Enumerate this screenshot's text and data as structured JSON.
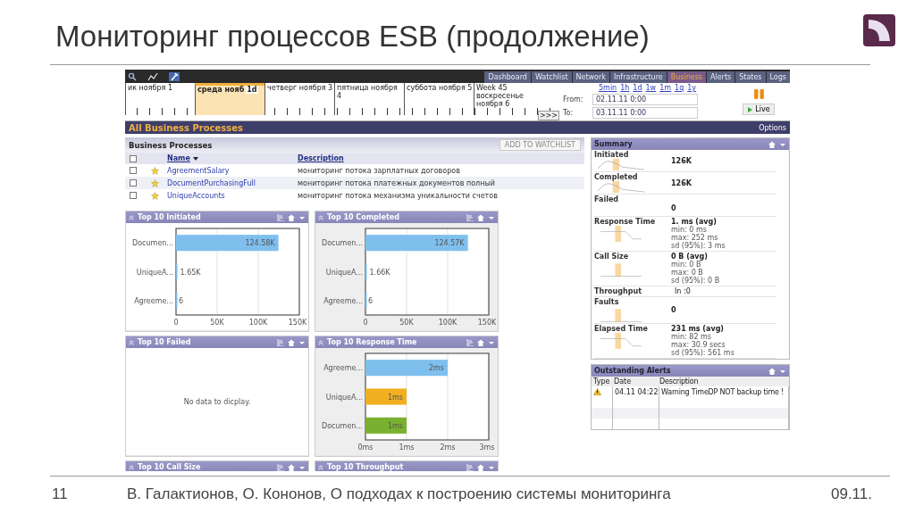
{
  "slide": {
    "title": "Мониторинг процессов ESB (продолжение)",
    "footer": {
      "page": "11",
      "text": "В. Галактионов, О. Кононов, О подходах к построению системы мониторинга",
      "date": "09.11."
    }
  },
  "tabs": [
    {
      "label": "Dashboard",
      "selected": false
    },
    {
      "label": "Watchlist",
      "selected": false
    },
    {
      "label": "Network",
      "selected": false
    },
    {
      "label": "Infrastructure",
      "selected": false
    },
    {
      "label": "Business",
      "selected": true
    },
    {
      "label": "Alerts",
      "selected": false
    },
    {
      "label": "States",
      "selected": false
    },
    {
      "label": "Logs",
      "selected": false
    }
  ],
  "timeline": {
    "days": [
      {
        "label": "ик ноября 1",
        "selected": false
      },
      {
        "label": "среда нояб",
        "selected": true,
        "badge": "1d"
      },
      {
        "label": "четверг ноября 3",
        "selected": false
      },
      {
        "label": "пятница ноября 4",
        "selected": false
      },
      {
        "label": "суббота ноября 5",
        "selected": false
      },
      {
        "label": "воскресенье ноября 6",
        "selected": false,
        "week": "Week 45"
      }
    ],
    "scroll": ">>>",
    "ranges": [
      "5min",
      "1h",
      "1d",
      "1w",
      "1m",
      "1q",
      "1y"
    ],
    "from_label": "From:",
    "from": "02.11.11 0:00",
    "to_label": "To:",
    "to": "03.11.11 0:00",
    "live": "Live"
  },
  "section": {
    "title": "All Business Processes",
    "options": "Options"
  },
  "business": {
    "title": "Business Processes",
    "add_button": "ADD TO WATCHLIST",
    "all_checked": false,
    "columns": [
      "Name",
      "Description"
    ],
    "rows": [
      {
        "name": "AgreementSalary",
        "description": "мониторинг потока зарплатных договоров",
        "checked": false
      },
      {
        "name": "DocumentPurchasingFull",
        "description": "мониторинг потока платежных документов полный",
        "checked": false
      },
      {
        "name": "UniqueAccounts",
        "description": "мониторинг потока механизма уникальности счетов",
        "checked": false
      }
    ]
  },
  "panels": [
    {
      "title": "Top 10 Initiated",
      "chart_data": {
        "type": "bar",
        "orientation": "horizontal",
        "categories": [
          "Documen...",
          "UniqueA...",
          "Agreeme..."
        ],
        "series": [
          {
            "color": "#7fbfee",
            "values": [
              124600,
              1650,
              6
            ]
          }
        ],
        "xlim": [
          0,
          150000
        ],
        "xticks": [
          {
            "value": 0,
            "label": "0"
          },
          {
            "value": 50000,
            "label": "50K"
          },
          {
            "value": 100000,
            "label": "100K"
          },
          {
            "value": 150000,
            "label": "150K"
          }
        ],
        "value_labels": [
          "124.58K",
          "1.65K",
          "6"
        ]
      }
    },
    {
      "title": "Top 10 Completed",
      "chart_data": {
        "type": "bar",
        "orientation": "horizontal",
        "categories": [
          "Documen...",
          "UniqueA...",
          "Agreeme..."
        ],
        "series": [
          {
            "color": "#7fbfee",
            "values": [
              124600,
              1660,
              6
            ]
          }
        ],
        "xlim": [
          0,
          150000
        ],
        "xticks": [
          {
            "value": 0,
            "label": "0"
          },
          {
            "value": 50000,
            "label": "50K"
          },
          {
            "value": 100000,
            "label": "100K"
          },
          {
            "value": 150000,
            "label": "150K"
          }
        ],
        "value_labels": [
          "124.57K",
          "1.66K",
          "6"
        ]
      }
    },
    {
      "title": "Top 10 Failed",
      "empty": "No data to dicplay."
    },
    {
      "title": "Top 10 Response Time",
      "chart_data": {
        "type": "bar",
        "orientation": "horizontal",
        "stacked": true,
        "categories": [
          "Agreeme...",
          "UniqueA...",
          "Documen..."
        ],
        "series": [
          {
            "color": "#7fbfee",
            "values": [
              2,
              null,
              null
            ]
          },
          {
            "color": "#f0b020",
            "values": [
              null,
              1,
              null
            ]
          },
          {
            "color": "#7ab030",
            "values": [
              null,
              null,
              1
            ]
          }
        ],
        "xlim": [
          0,
          3
        ],
        "xticks": [
          {
            "value": 0,
            "label": "0ms"
          },
          {
            "value": 1,
            "label": "1ms"
          },
          {
            "value": 2,
            "label": "2ms"
          },
          {
            "value": 3,
            "label": "3ms"
          }
        ],
        "value_labels": [
          "2ms",
          "1ms",
          "1ms"
        ]
      }
    },
    {
      "title": "Top 10 Call Size"
    },
    {
      "title": "Top 10 Throughput"
    }
  ],
  "summary": {
    "title": "Summary",
    "rows": [
      {
        "label": "Initiated",
        "kind": "curve",
        "value": "126K"
      },
      {
        "label": "Completed",
        "kind": "curve",
        "value": "126K"
      },
      {
        "label": "Failed",
        "kind": "blank",
        "value": "0"
      },
      {
        "label": "Response Time",
        "kind": "step",
        "value": "1. ms (avg)",
        "details": [
          "min: 0 ms",
          "max: 252 ms",
          "sd (95%): 3 ms"
        ]
      },
      {
        "label": "Call Size",
        "kind": "bar",
        "value": "0 B (avg)",
        "details": [
          "min: 0 B",
          "max: 0 B",
          "sd (95%): 0 B"
        ]
      },
      {
        "label": "Throughput",
        "kind": "inline",
        "value": "In :0"
      },
      {
        "label": "Faults",
        "kind": "bar",
        "value": "0"
      },
      {
        "label": "Elapsed Time",
        "kind": "step",
        "value": "231 ms (avg)",
        "details": [
          "min: 82 ms",
          "max: 30.9 secs",
          "sd (95%): 561 ms"
        ]
      }
    ]
  },
  "alerts": {
    "title": "Outstanding Alerts",
    "columns": [
      "Type",
      "Date",
      "Description"
    ],
    "rows": [
      {
        "kind": "warning",
        "date": "04.11 04:22",
        "description": "Warning TimeDP NOT backup time !"
      }
    ]
  }
}
